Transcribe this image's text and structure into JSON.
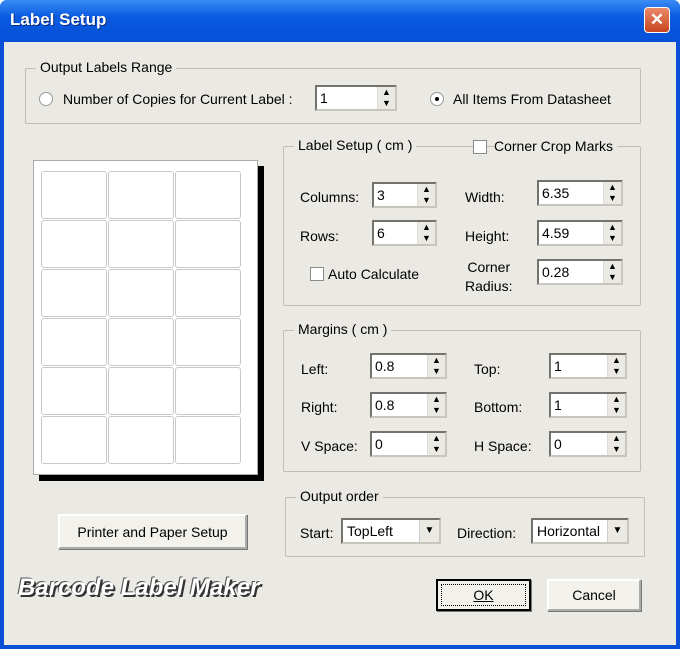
{
  "window": {
    "title": "Label Setup",
    "close": "✕"
  },
  "range": {
    "legend": "Output Labels Range",
    "copies_label": "Number of Copies for Current Label :",
    "copies_value": "1",
    "all_items_label": "All Items From Datasheet",
    "selected": "all_items"
  },
  "label_setup": {
    "legend": "Label Setup  ( cm )",
    "corner_crop_label": "Corner Crop Marks",
    "corner_crop_checked": false,
    "columns_label": "Columns:",
    "columns": "3",
    "rows_label": "Rows:",
    "rows": "6",
    "auto_calc_label": "Auto Calculate",
    "auto_calc_checked": false,
    "width_label": "Width:",
    "width": "6.35",
    "height_label": "Height:",
    "height": "4.59",
    "corner_label1": "Corner",
    "corner_label2": "Radius:",
    "corner_radius": "0.28"
  },
  "margins": {
    "legend": "Margins ( cm )",
    "left_label": "Left:",
    "left": "0.8",
    "right_label": "Right:",
    "right": "0.8",
    "vspace_label": "V Space:",
    "vspace": "0",
    "top_label": "Top:",
    "top": "1",
    "bottom_label": "Bottom:",
    "bottom": "1",
    "hspace_label": "H Space:",
    "hspace": "0"
  },
  "order": {
    "legend": "Output order",
    "start_label": "Start:",
    "start": "TopLeft",
    "direction_label": "Direction:",
    "direction": "Horizontal"
  },
  "buttons": {
    "printer": "Printer and Paper Setup",
    "ok": "OK",
    "cancel": "Cancel"
  },
  "brand": "Barcode Label Maker"
}
